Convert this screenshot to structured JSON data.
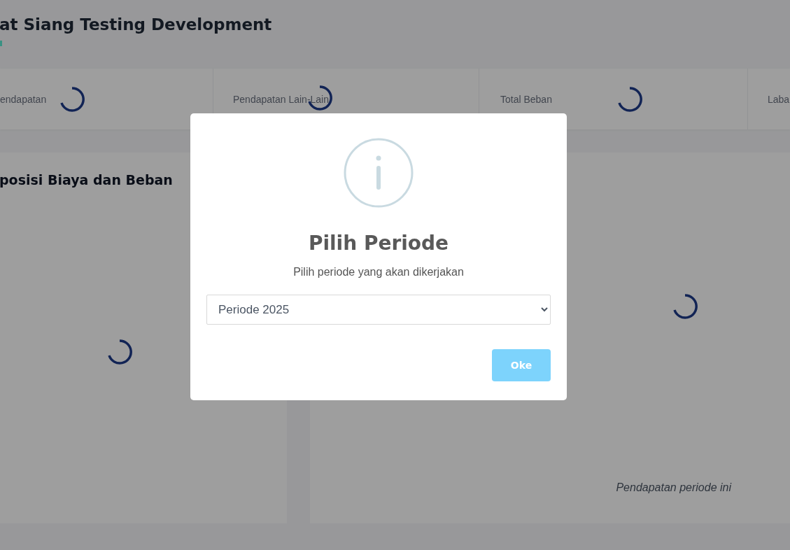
{
  "header": {
    "title": "at Siang Testing Development"
  },
  "stats": [
    {
      "label": "endapatan"
    },
    {
      "label": "Pendapatan Lain-Lain"
    },
    {
      "label": "Total Beban"
    },
    {
      "label": "Laba"
    }
  ],
  "panels": [
    {
      "title": "posisi Biaya dan Beban"
    },
    {
      "caption": "Pendapatan periode ini"
    }
  ],
  "modal": {
    "title": "Pilih Periode",
    "text": "Pilih periode yang akan dikerjakan",
    "select": {
      "value": "Periode 2025"
    },
    "button": "Oke"
  }
}
